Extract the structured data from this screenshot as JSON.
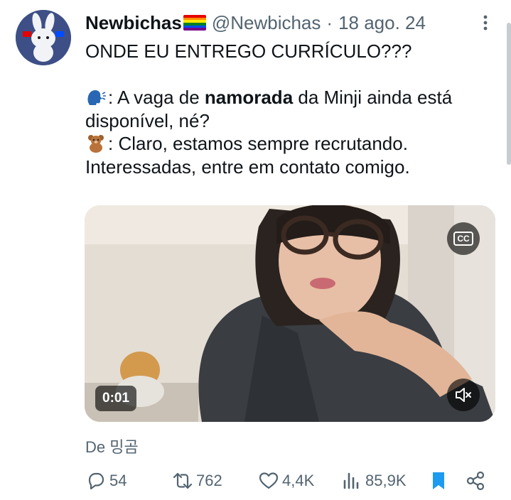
{
  "tweet": {
    "display_name": "Newbichas",
    "handle": "@Newbichas",
    "separator": "·",
    "date": "18 ago. 24",
    "line1": "ONDE EU ENTREGO CURRÍCULO???",
    "q_pre": ": A vaga de ",
    "q_bold": "namorada",
    "q_post": " da Minji ainda está disponível, né?",
    "a_text": ": Claro, estamos sempre recrutando. Interessadas, entre em contato comigo."
  },
  "media": {
    "cc_label": "CC",
    "timestamp": "0:01"
  },
  "source": "De 밍곰",
  "metrics": {
    "replies": "54",
    "retweets": "762",
    "likes": "4,4K",
    "views": "85,9K"
  },
  "icons": {
    "avatar": "bunny-avatar",
    "flag": "rainbow-flag-emoji",
    "speaker": "speaking-head-emoji",
    "bear": "teddy-bear-emoji",
    "reply": "reply-icon",
    "retweet": "retweet-icon",
    "like": "heart-icon",
    "views": "views-icon",
    "bookmark": "bookmark-icon",
    "share": "share-icon",
    "more": "more-icon",
    "mute": "muted-speaker-icon"
  },
  "colors": {
    "text": "#0f1419",
    "secondary": "#536471",
    "accent": "#1d9bf0",
    "flag": [
      "#e40303",
      "#ff8c00",
      "#ffed00",
      "#008026",
      "#004dff",
      "#750787"
    ]
  }
}
